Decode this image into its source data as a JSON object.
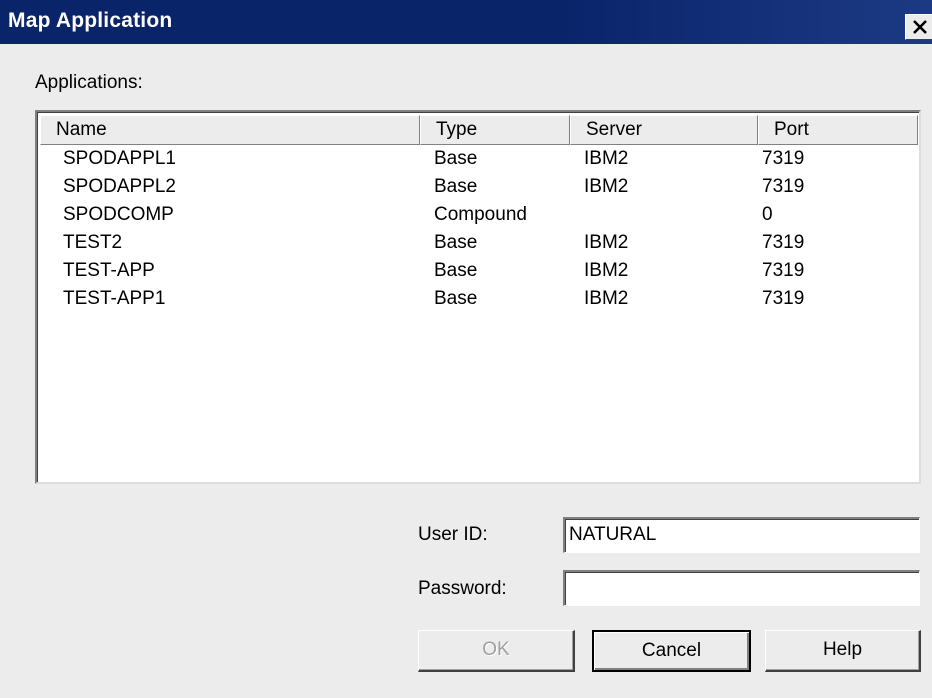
{
  "window": {
    "title": "Map Application",
    "close_icon": "close-icon"
  },
  "applications": {
    "label": "Applications:",
    "columns": [
      "Name",
      "Type",
      "Server",
      "Port"
    ],
    "rows": [
      {
        "name": "SPODAPPL1",
        "type": "Base",
        "server": "IBM2",
        "port": "7319"
      },
      {
        "name": "SPODAPPL2",
        "type": "Base",
        "server": "IBM2",
        "port": "7319"
      },
      {
        "name": "SPODCOMP",
        "type": "Compound",
        "server": "",
        "port": "0"
      },
      {
        "name": "TEST2",
        "type": "Base",
        "server": "IBM2",
        "port": "7319"
      },
      {
        "name": "TEST-APP",
        "type": "Base",
        "server": "IBM2",
        "port": "7319"
      },
      {
        "name": "TEST-APP1",
        "type": "Base",
        "server": "IBM2",
        "port": "7319"
      }
    ]
  },
  "form": {
    "user_id_label": "User ID:",
    "user_id_value": "NATURAL",
    "password_label": "Password:",
    "password_value": ""
  },
  "buttons": {
    "ok": "OK",
    "cancel": "Cancel",
    "help": "Help"
  }
}
